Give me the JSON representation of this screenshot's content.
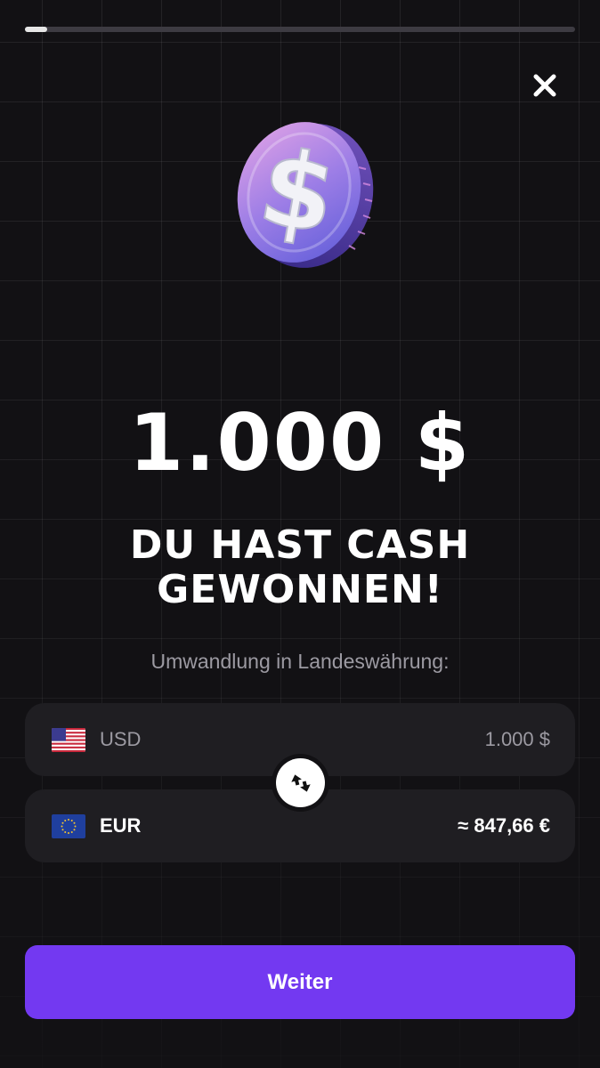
{
  "progress": {
    "fraction": 0.04
  },
  "header": {
    "close_icon": "close-icon"
  },
  "reward": {
    "icon": "dollar-coin-icon",
    "amount": "1.000 $",
    "headline_line1": "DU HAST CASH",
    "headline_line2": "GEWONNEN!",
    "conversion_label": "Umwandlung in Landeswährung:"
  },
  "conversion": {
    "from": {
      "flag_icon": "us-flag-icon",
      "code": "USD",
      "value": "1.000 $"
    },
    "to": {
      "flag_icon": "eu-flag-icon",
      "code": "EUR",
      "value": "≈ 847,66 €"
    },
    "swap_icon": "swap-arrows-icon"
  },
  "footer": {
    "continue_label": "Weiter"
  },
  "colors": {
    "background": "#121114",
    "accent": "#7339f1",
    "card": "#1f1e22",
    "muted_text": "#9c9aa2"
  }
}
